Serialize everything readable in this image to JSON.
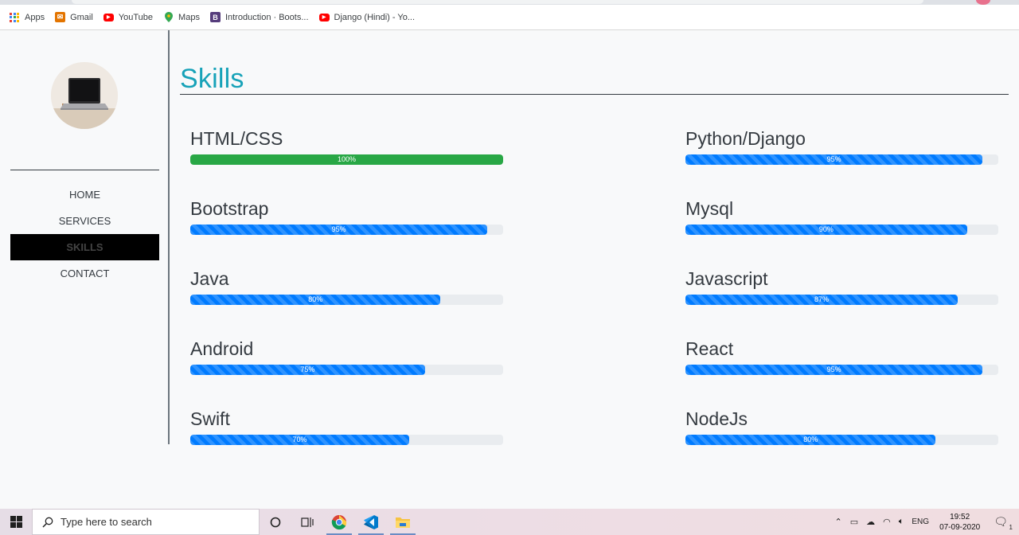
{
  "bookmarks": [
    {
      "label": "Apps",
      "icon": "apps-grid-icon"
    },
    {
      "label": "Gmail",
      "icon": "gmail-icon",
      "color": "#e37400"
    },
    {
      "label": "YouTube",
      "icon": "youtube-icon",
      "color": "#ff0000"
    },
    {
      "label": "Maps",
      "icon": "maps-pin-icon",
      "color": "#34a853"
    },
    {
      "label": "Introduction · Boots...",
      "icon": "bootstrap-icon",
      "color": "#563d7c",
      "glyph": "B"
    },
    {
      "label": "Django (Hindi) - Yo...",
      "icon": "youtube-icon",
      "color": "#ff0000"
    }
  ],
  "sidebar": {
    "nav": [
      {
        "label": "HOME",
        "active": false
      },
      {
        "label": "SERVICES",
        "active": false
      },
      {
        "label": "SKILLS",
        "active": true
      },
      {
        "label": "CONTACT",
        "active": false
      }
    ]
  },
  "main": {
    "title": "Skills",
    "skills_left": [
      {
        "name": "HTML/CSS",
        "percent": 100,
        "label": "100%",
        "style": "success"
      },
      {
        "name": "Bootstrap",
        "percent": 95,
        "label": "95%",
        "style": "striped"
      },
      {
        "name": "Java",
        "percent": 80,
        "label": "80%",
        "style": "striped"
      },
      {
        "name": "Android",
        "percent": 75,
        "label": "75%",
        "style": "striped"
      },
      {
        "name": "Swift",
        "percent": 70,
        "label": "70%",
        "style": "striped"
      }
    ],
    "skills_right": [
      {
        "name": "Python/Django",
        "percent": 95,
        "label": "95%",
        "style": "striped"
      },
      {
        "name": "Mysql",
        "percent": 90,
        "label": "90%",
        "style": "striped"
      },
      {
        "name": "Javascript",
        "percent": 87,
        "label": "87%",
        "style": "striped"
      },
      {
        "name": "React",
        "percent": 95,
        "label": "95%",
        "style": "striped"
      },
      {
        "name": "NodeJs",
        "percent": 80,
        "label": "80%",
        "style": "striped"
      }
    ]
  },
  "colors": {
    "title": "#17a2b8",
    "bar_primary": "#007bff",
    "bar_success": "#28a745"
  },
  "taskbar": {
    "search_placeholder": "Type here to search",
    "language": "ENG",
    "time": "19:52",
    "date": "07-09-2020",
    "notification_count": "1"
  }
}
